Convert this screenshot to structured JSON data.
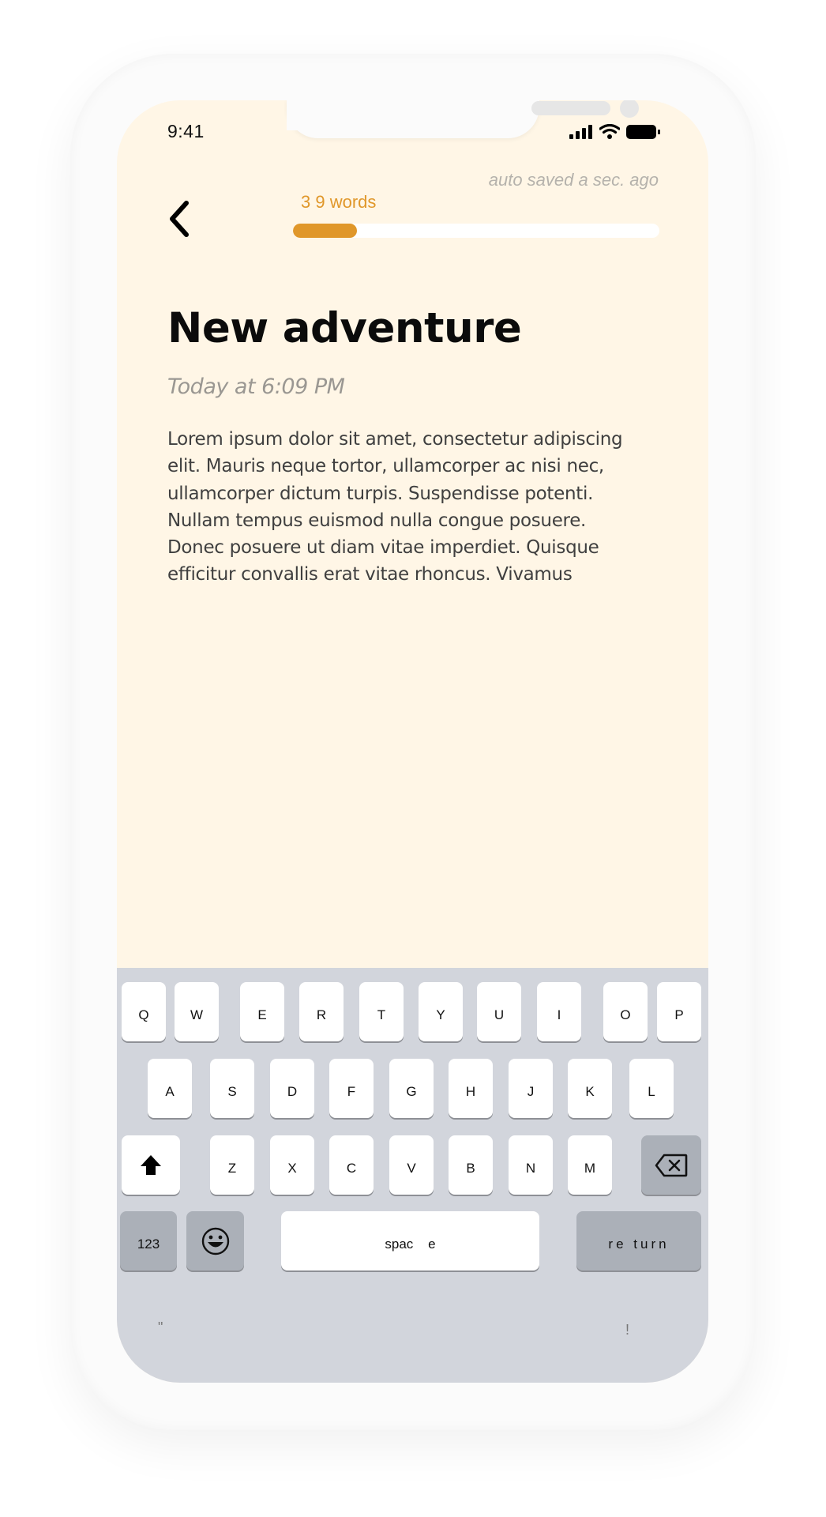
{
  "status_bar": {
    "time": "9:41",
    "icons": [
      "cellular-signal-icon",
      "wifi-icon",
      "battery-icon"
    ]
  },
  "header": {
    "back_icon": "chevron-left-icon",
    "word_count_label": "3 9  words",
    "word_count": 39,
    "autosave_status": "auto saved a sec. ago",
    "progress_fraction": 0.175,
    "accent_color": "#e0972a"
  },
  "entry": {
    "title": "New adventure",
    "date": "Today at 6:09 PM",
    "body_lines": [
      "Lorem ipsum dolor sit amet, consectetur adipiscing",
      "elit. Mauris neque tortor, ullamcorper ac nisi nec,",
      "ullamcorper dictum turpis. Suspendisse potenti.",
      "Nullam tempus euismod nulla congue posuere.",
      "Donec posuere ut diam vitae imperdiet. Quisque",
      "efficitur convallis erat vitae rhoncus. Vivamus"
    ]
  },
  "keyboard": {
    "row1": [
      "Q",
      "W",
      "E",
      "R",
      "T",
      "Y",
      "U",
      "I",
      "O",
      "P"
    ],
    "row2": [
      "A",
      "S",
      "D",
      "F",
      "G",
      "H",
      "J",
      "K",
      "L"
    ],
    "row3": [
      "Z",
      "X",
      "C",
      "V",
      "B",
      "N",
      "M"
    ],
    "shift_icon": "shift-arrow-icon",
    "delete_icon": "backspace-icon",
    "numbers_label": "123",
    "emoji_icon": "emoji-smile-icon",
    "space_label": "spac    e",
    "return_label": "re turn",
    "bottom_hints": [
      "\"",
      "!"
    ]
  }
}
